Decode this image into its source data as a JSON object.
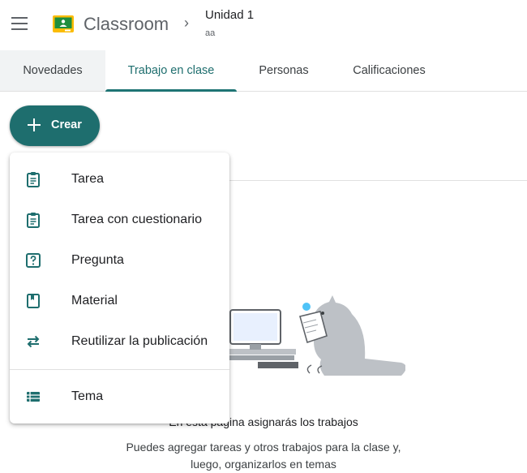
{
  "header": {
    "app_title": "Classroom",
    "class_name": "Unidad 1",
    "class_section": "aa",
    "icons": {
      "menu": "hamburger-menu-icon",
      "logo": "classroom-logo-icon",
      "separator": "chevron-right-icon"
    }
  },
  "tabs": [
    {
      "label": "Novedades",
      "state": "inactive"
    },
    {
      "label": "Trabajo en clase",
      "state": "active"
    },
    {
      "label": "Personas",
      "state": "inactive"
    },
    {
      "label": "Calificaciones",
      "state": "inactive"
    }
  ],
  "create_button": {
    "label": "Crear",
    "icon": "plus-icon"
  },
  "create_menu": {
    "items": [
      {
        "label": "Tarea",
        "icon": "assignment-icon"
      },
      {
        "label": "Tarea con cuestionario",
        "icon": "quiz-assignment-icon"
      },
      {
        "label": "Pregunta",
        "icon": "question-icon"
      },
      {
        "label": "Material",
        "icon": "material-icon"
      },
      {
        "label": "Reutilizar la publicación",
        "icon": "reuse-post-icon"
      },
      {
        "label": "Tema",
        "icon": "topic-icon"
      }
    ]
  },
  "empty_state": {
    "title": "En esta página asignarás los trabajos",
    "description_line1": "Puedes agregar tareas y otros trabajos para la clase y,",
    "description_line2": "luego, organizarlos en temas"
  },
  "colors": {
    "accent": "#1e6e6e",
    "logo_green": "#1e8e3e",
    "logo_yellow": "#fbbc04",
    "text": "#202124",
    "muted": "#5f6368"
  }
}
